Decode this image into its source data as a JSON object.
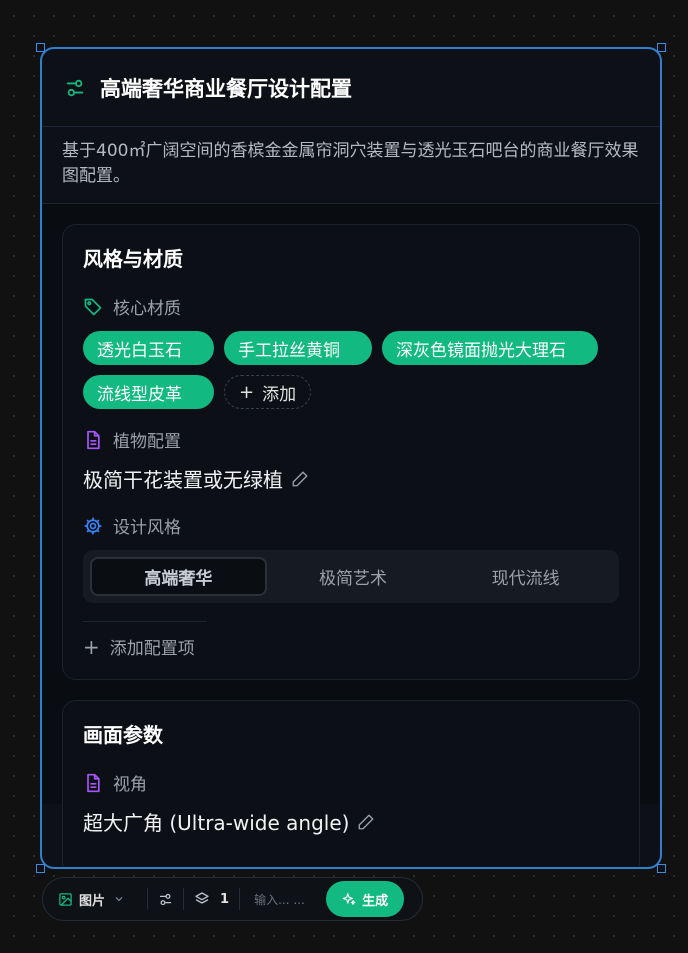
{
  "panel": {
    "title": "高端奢华商业餐厅设计配置",
    "description": "基于400㎡广阔空间的香槟金金属帘洞穴装置与透光玉石吧台的商业餐厅效果图配置。",
    "icon": "sliders-icon"
  },
  "style_card": {
    "title": "风格与材质",
    "materials": {
      "label": "核心材质",
      "icon": "tag-icon",
      "chips": [
        "透光白玉石",
        "手工拉丝黄铜",
        "深灰色镜面抛光大理石",
        "流线型皮革"
      ],
      "add_label": "添加"
    },
    "plants": {
      "label": "植物配置",
      "icon": "document-icon",
      "value": "极简干花装置或无绿植"
    },
    "design_style": {
      "label": "设计风格",
      "icon": "gear-icon",
      "options": [
        "高端奢华",
        "极简艺术",
        "现代流线"
      ],
      "selected": "高端奢华"
    },
    "add_config_label": "添加配置项"
  },
  "canvas_card": {
    "title": "画面参数",
    "view": {
      "label": "视角",
      "icon": "document-icon",
      "value": "超大广角 (Ultra-wide angle)"
    }
  },
  "toolbar": {
    "mode_label": "图片",
    "layers_count": "1",
    "input_placeholder": "输入... ...",
    "generate_label": "生成"
  },
  "colors": {
    "accent": "#12b981",
    "selection": "#2f7fcf",
    "background": "#111111",
    "panel": "#0d1117",
    "purple_icon": "#a855f7",
    "blue_icon": "#3b82f6"
  }
}
